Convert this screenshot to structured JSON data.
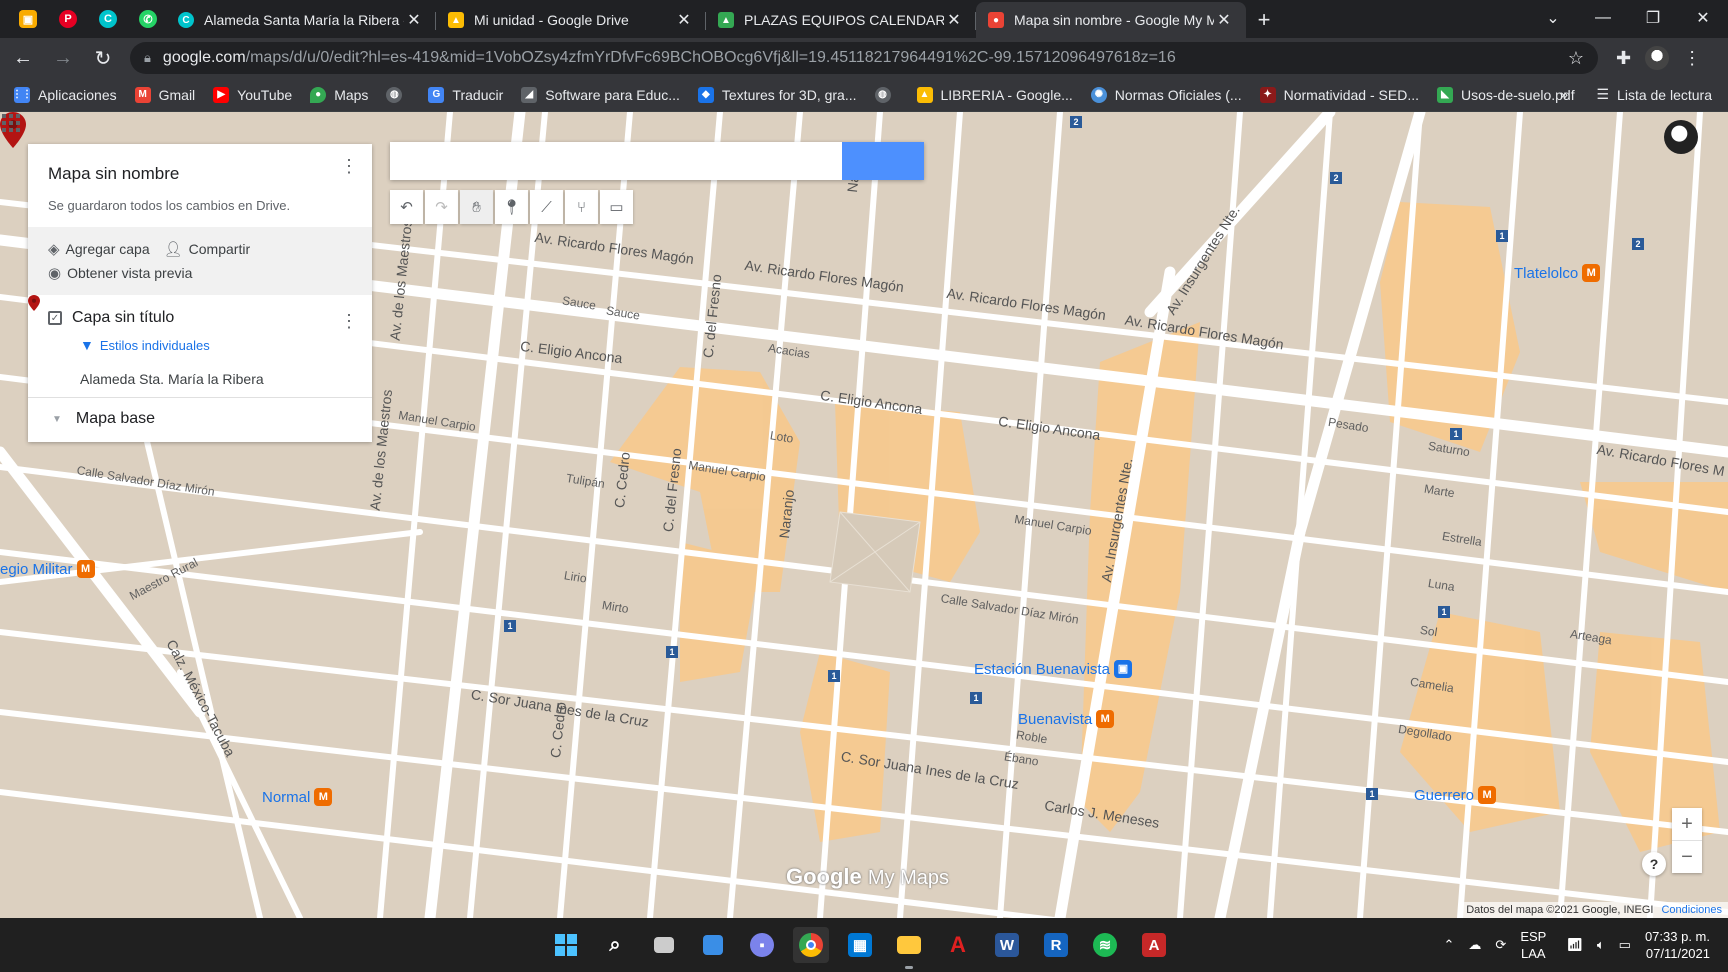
{
  "pinned_tabs": [
    {
      "icon": "photos-icon",
      "color": "#f9ab00"
    },
    {
      "icon": "pinterest-icon",
      "color": "#e60023"
    },
    {
      "icon": "canva-icon",
      "color": "#00c4cc"
    },
    {
      "icon": "whatsapp-icon",
      "color": "#25d366"
    }
  ],
  "tabs": [
    {
      "title": "Alameda Santa María la Ribera -",
      "icon": "canva-icon",
      "color": "#00c4cc",
      "active": false
    },
    {
      "title": "Mi unidad - Google Drive",
      "icon": "drive-icon",
      "color": "#fbbc04",
      "active": false
    },
    {
      "title": "PLAZAS EQUIPOS CALENDARIO",
      "icon": "drive-icon",
      "color": "#34a853",
      "active": false
    },
    {
      "title": "Mapa sin nombre - Google My M",
      "icon": "mymaps-icon",
      "color": "#ea4335",
      "active": true
    }
  ],
  "url": {
    "host": "google.com",
    "path": "/maps/d/u/0/edit?hl=es-419&mid=1VobOZsy4zfmYrDfvFc69BChOBOcg6Vfj&ll=19.45118217964491%2C-99.15712096497618z=16"
  },
  "bookmarks": [
    {
      "label": "Aplicaciones",
      "icon": "apps-grid-icon",
      "color": "#4285f4"
    },
    {
      "label": "Gmail",
      "icon": "gmail-icon",
      "color": "#ea4335"
    },
    {
      "label": "YouTube",
      "icon": "youtube-icon",
      "color": "#ff0000"
    },
    {
      "label": "Maps",
      "icon": "maps-icon",
      "color": "#34a853"
    },
    {
      "label": "",
      "icon": "globe-icon",
      "color": "#5f6368"
    },
    {
      "label": "Traducir",
      "icon": "translate-icon",
      "color": "#4285f4"
    },
    {
      "label": "Software para Educ...",
      "icon": "software-icon",
      "color": "#5f6368"
    },
    {
      "label": "Textures for 3D, gra...",
      "icon": "textures-icon",
      "color": "#1a73e8"
    },
    {
      "label": "",
      "icon": "globe-icon",
      "color": "#5f6368"
    },
    {
      "label": "LIBRERIA - Google...",
      "icon": "drive-icon",
      "color": "#fbbc04"
    },
    {
      "label": "Normas Oficiales (...",
      "icon": "normas-icon",
      "color": "#4a90d9"
    },
    {
      "label": "Normatividad - SED...",
      "icon": "sedema-icon",
      "color": "#8b1a1a"
    },
    {
      "label": "Usos-de-suelo.pdf",
      "icon": "pdf-icon",
      "color": "#34a853"
    }
  ],
  "bookmarks_more": "»",
  "reading_list": "Lista de lectura",
  "panel": {
    "title": "Mapa sin nombre",
    "subtitle": "Se guardaron todos los cambios en Drive.",
    "add_layer": "Agregar capa",
    "share": "Compartir",
    "preview": "Obtener vista previa",
    "layer_title": "Capa sin título",
    "layer_styles": "Estilos individuales",
    "feature": "Alameda Sta. María la Ribera",
    "base_map": "Mapa base"
  },
  "search": {
    "placeholder": ""
  },
  "map_labels": {
    "streets": [
      "Av. Ricardo Flores Magón",
      "Av. Ricardo Flores Magón",
      "Av. Ricardo Flores Magón",
      "Av. Ricardo Flores Magón",
      "Av. Ricardo Flores M",
      "C. Eligio Ancona",
      "C. Eligio Ancona",
      "C. Eligio Ancona",
      "Av. de los Maestros",
      "Av. de los Maestros",
      "Av. Insurgentes Nte.",
      "Av. Insurgentes Nte.",
      "C. Sor Juana Ines de la Cruz",
      "C. Sor Juana Ines de la Cruz",
      "Calle Salvador Díaz Mirón",
      "Calle Salvador Díaz Mirón",
      "Manuel Carpio",
      "Manuel Carpio",
      "Manuel Carpio",
      "Naranjo",
      "Naranjo",
      "C. del Fresno",
      "C. del Fresno",
      "C. Cedro",
      "C. Cedro",
      "Sauce",
      "Sauce",
      "Acacias",
      "Loto",
      "Tulipán",
      "Lirio",
      "Mirto",
      "Pesado",
      "Saturno",
      "Marte",
      "Estrella",
      "Luna",
      "Sol",
      "Arteaga",
      "Camelia",
      "Degollado",
      "Carlos J. Meneses",
      "Calz. México-Tacuba",
      "Maestro Rural",
      "Ébano",
      "Roble"
    ],
    "poi_tlatelolco": "Tlatelolco",
    "poi_colegio": "egio Militar",
    "poi_estacion": "Estación Buenavista",
    "poi_buenavista": "Buenavista",
    "poi_normal": "Normal",
    "poi_guerrero": "Guerrero"
  },
  "branding": {
    "google": "Google",
    "mymaps": "My Maps"
  },
  "credit": {
    "data": "Datos del mapa ©2021 Google, INEGI",
    "terms": "Condiciones"
  },
  "zoom": {
    "in": "+",
    "out": "−"
  },
  "help": "?",
  "taskbar": {
    "apps": [
      {
        "name": "start-icon",
        "color": "#4cc2ff",
        "state": ""
      },
      {
        "name": "search-icon",
        "color": "#ffffff",
        "state": ""
      },
      {
        "name": "task-view-icon",
        "color": "#cccccc",
        "state": ""
      },
      {
        "name": "widgets-icon",
        "color": "#3a8ee6",
        "state": ""
      },
      {
        "name": "teams-chat-icon",
        "color": "#7b83eb",
        "state": ""
      },
      {
        "name": "chrome-icon",
        "color": "#ea4335",
        "state": "active"
      },
      {
        "name": "store-icon",
        "color": "#0078d4",
        "state": ""
      },
      {
        "name": "file-explorer-icon",
        "color": "#ffc83d",
        "state": "open"
      },
      {
        "name": "acrobat-icon",
        "color": "#e02020",
        "state": ""
      },
      {
        "name": "word-icon",
        "color": "#2b579a",
        "state": ""
      },
      {
        "name": "revit-icon",
        "color": "#1565c0",
        "state": ""
      },
      {
        "name": "spotify-icon",
        "color": "#1db954",
        "state": ""
      },
      {
        "name": "autocad-icon",
        "color": "#c62828",
        "state": ""
      }
    ],
    "lang": "ESP",
    "lang_sub": "LAA",
    "time": "07:33 p. m.",
    "date": "07/11/2021"
  }
}
